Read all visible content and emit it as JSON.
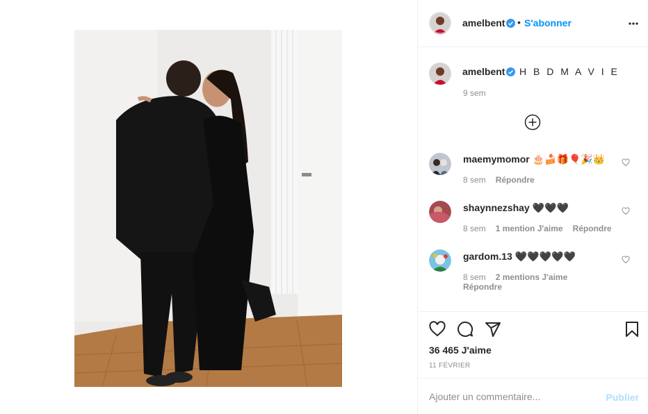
{
  "post": {
    "author": "amelbent",
    "verified": true,
    "follow_label": "S'abonner",
    "separator": "•",
    "more_icon": "more-horizontal-icon"
  },
  "caption": {
    "user": "amelbent",
    "text": "H B D M A V I E",
    "time": "9 sem"
  },
  "comments": [
    {
      "user": "maemymomor",
      "text": "🎂🍰🎁🎈🎉👑",
      "time": "8 sem",
      "likes": "",
      "reply": "Répondre"
    },
    {
      "user": "shaynnezshay",
      "text": "🖤🖤🖤",
      "time": "8 sem",
      "likes": "1 mention J'aime",
      "reply": "Répondre"
    },
    {
      "user": "gardom.13",
      "text": "🖤🖤🖤🖤🖤",
      "time": "8 sem",
      "likes": "2 mentions J'aime",
      "reply": "Répondre"
    }
  ],
  "actions": {
    "likes_count": "36 465 J'aime",
    "date": "11 FÉVRIER",
    "icons": [
      "heart-icon",
      "comment-icon",
      "share-icon",
      "bookmark-icon"
    ]
  },
  "add_comment": {
    "placeholder": "Ajouter un commentaire...",
    "publish_label": "Publier"
  },
  "colors": {
    "accent": "#0095f6",
    "publish_disabled": "#b2dffc",
    "muted": "#8e8e8e",
    "text": "#262626",
    "border": "#efefef"
  }
}
